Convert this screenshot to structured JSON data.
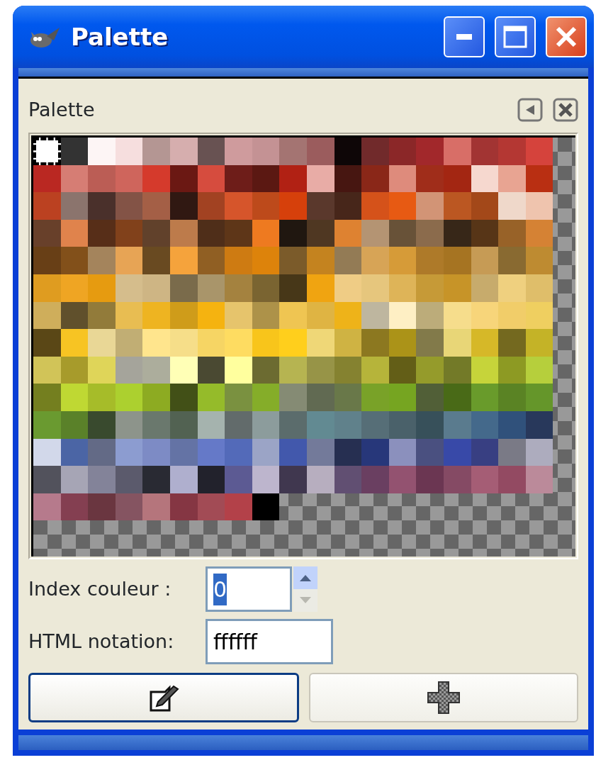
{
  "window": {
    "title": "Palette"
  },
  "panel": {
    "title": "Palette"
  },
  "palette": {
    "rows": [
      [
        {
          "color": "#ffffff",
          "selected": true
        },
        {
          "color": "#333333",
          "selected": false
        },
        {
          "color": "#fdf5f5",
          "selected": false
        },
        {
          "color": "#f6dede",
          "selected": false
        },
        {
          "color": "#b49693",
          "selected": false
        },
        {
          "color": "#d6aeae",
          "selected": false
        },
        {
          "color": "#685252",
          "selected": false
        },
        {
          "color": "#cf9b9d",
          "selected": false
        },
        {
          "color": "#c49294",
          "selected": false
        },
        {
          "color": "#a47472",
          "selected": false
        },
        {
          "color": "#9b5c5d",
          "selected": false
        },
        {
          "color": "#0e0607",
          "selected": false
        },
        {
          "color": "#712a2b",
          "selected": false
        },
        {
          "color": "#8b2728",
          "selected": false
        },
        {
          "color": "#a2282b",
          "selected": false
        },
        {
          "color": "#d86e67",
          "selected": false
        },
        {
          "color": "#a23433",
          "selected": false
        },
        {
          "color": "#b43733",
          "selected": false
        },
        {
          "color": "#d5433c",
          "selected": false
        }
      ],
      [
        {
          "color": "#ba2822",
          "selected": false
        },
        {
          "color": "#d67d74",
          "selected": false
        },
        {
          "color": "#bb5d55",
          "selected": false
        },
        {
          "color": "#cf655c",
          "selected": false
        },
        {
          "color": "#d53a2c",
          "selected": false
        },
        {
          "color": "#6b1813",
          "selected": false
        },
        {
          "color": "#d64c3e",
          "selected": false
        },
        {
          "color": "#6e1d19",
          "selected": false
        },
        {
          "color": "#5b1812",
          "selected": false
        },
        {
          "color": "#b12114",
          "selected": false
        },
        {
          "color": "#e8aca6",
          "selected": false
        },
        {
          "color": "#471611",
          "selected": false
        },
        {
          "color": "#8a2718",
          "selected": false
        },
        {
          "color": "#de8b7c",
          "selected": false
        },
        {
          "color": "#a02d1a",
          "selected": false
        },
        {
          "color": "#a32612",
          "selected": false
        },
        {
          "color": "#f6d8cf",
          "selected": false
        },
        {
          "color": "#e8a492",
          "selected": false
        },
        {
          "color": "#b92f12",
          "selected": false
        }
      ],
      [
        {
          "color": "#bb4121",
          "selected": false
        },
        {
          "color": "#8b746d",
          "selected": false
        },
        {
          "color": "#4a302b",
          "selected": false
        },
        {
          "color": "#835346",
          "selected": false
        },
        {
          "color": "#a45f46",
          "selected": false
        },
        {
          "color": "#301812",
          "selected": false
        },
        {
          "color": "#a24222",
          "selected": false
        },
        {
          "color": "#d6552b",
          "selected": false
        },
        {
          "color": "#bd4a1b",
          "selected": false
        },
        {
          "color": "#d6400b",
          "selected": false
        },
        {
          "color": "#5a382c",
          "selected": false
        },
        {
          "color": "#47261a",
          "selected": false
        },
        {
          "color": "#d5521a",
          "selected": false
        },
        {
          "color": "#e75a13",
          "selected": false
        },
        {
          "color": "#d29476",
          "selected": false
        },
        {
          "color": "#bb5722",
          "selected": false
        },
        {
          "color": "#a34819",
          "selected": false
        },
        {
          "color": "#efd8ca",
          "selected": false
        },
        {
          "color": "#efc4ae",
          "selected": false
        }
      ],
      [
        {
          "color": "#68402a",
          "selected": false
        },
        {
          "color": "#e0834c",
          "selected": false
        },
        {
          "color": "#572e18",
          "selected": false
        },
        {
          "color": "#81411b",
          "selected": false
        },
        {
          "color": "#61412b",
          "selected": false
        },
        {
          "color": "#bd7b4b",
          "selected": false
        },
        {
          "color": "#4f2e19",
          "selected": false
        },
        {
          "color": "#5e3618",
          "selected": false
        },
        {
          "color": "#ee7a20",
          "selected": false
        },
        {
          "color": "#201710",
          "selected": false
        },
        {
          "color": "#4f3722",
          "selected": false
        },
        {
          "color": "#de8231",
          "selected": false
        },
        {
          "color": "#b49473",
          "selected": false
        },
        {
          "color": "#685238",
          "selected": false
        },
        {
          "color": "#8b6b4c",
          "selected": false
        },
        {
          "color": "#372718",
          "selected": false
        },
        {
          "color": "#573517",
          "selected": false
        },
        {
          "color": "#986228",
          "selected": false
        },
        {
          "color": "#d58234",
          "selected": false
        }
      ],
      [
        {
          "color": "#683f16",
          "selected": false
        },
        {
          "color": "#82501a",
          "selected": false
        },
        {
          "color": "#a4845c",
          "selected": false
        },
        {
          "color": "#e7a455",
          "selected": false
        },
        {
          "color": "#694a21",
          "selected": false
        },
        {
          "color": "#f5a33c",
          "selected": false
        },
        {
          "color": "#905f23",
          "selected": false
        },
        {
          "color": "#ce7b12",
          "selected": false
        },
        {
          "color": "#dd830b",
          "selected": false
        },
        {
          "color": "#7b5b2a",
          "selected": false
        },
        {
          "color": "#c4831f",
          "selected": false
        },
        {
          "color": "#937b55",
          "selected": false
        },
        {
          "color": "#d7a456",
          "selected": false
        },
        {
          "color": "#d69b38",
          "selected": false
        },
        {
          "color": "#ae7a29",
          "selected": false
        },
        {
          "color": "#a67422",
          "selected": false
        },
        {
          "color": "#c69b55",
          "selected": false
        },
        {
          "color": "#896a31",
          "selected": false
        },
        {
          "color": "#be8b31",
          "selected": false
        }
      ],
      [
        {
          "color": "#df9c20",
          "selected": false
        },
        {
          "color": "#efa523",
          "selected": false
        },
        {
          "color": "#e69b10",
          "selected": false
        },
        {
          "color": "#d5bd8c",
          "selected": false
        },
        {
          "color": "#ceb584",
          "selected": false
        },
        {
          "color": "#7a6b4b",
          "selected": false
        },
        {
          "color": "#a9956a",
          "selected": false
        },
        {
          "color": "#a4823f",
          "selected": false
        },
        {
          "color": "#7a6431",
          "selected": false
        },
        {
          "color": "#473718",
          "selected": false
        },
        {
          "color": "#f0a411",
          "selected": false
        },
        {
          "color": "#efcc85",
          "selected": false
        },
        {
          "color": "#e6c67d",
          "selected": false
        },
        {
          "color": "#deb458",
          "selected": false
        },
        {
          "color": "#c69a37",
          "selected": false
        },
        {
          "color": "#c79428",
          "selected": false
        },
        {
          "color": "#c7ab6c",
          "selected": false
        },
        {
          "color": "#efd07f",
          "selected": false
        },
        {
          "color": "#dfbe6a",
          "selected": false
        }
      ],
      [
        {
          "color": "#cfae5b",
          "selected": false
        },
        {
          "color": "#60502c",
          "selected": false
        },
        {
          "color": "#927b3a",
          "selected": false
        },
        {
          "color": "#e8bd52",
          "selected": false
        },
        {
          "color": "#eeb421",
          "selected": false
        },
        {
          "color": "#cf9c1a",
          "selected": false
        },
        {
          "color": "#f5b310",
          "selected": false
        },
        {
          "color": "#e6c46c",
          "selected": false
        },
        {
          "color": "#ad9249",
          "selected": false
        },
        {
          "color": "#efc552",
          "selected": false
        },
        {
          "color": "#dfb443",
          "selected": false
        },
        {
          "color": "#eeb319",
          "selected": false
        },
        {
          "color": "#beb69f",
          "selected": false
        },
        {
          "color": "#feefc4",
          "selected": false
        },
        {
          "color": "#bcac7a",
          "selected": false
        },
        {
          "color": "#f6dd8c",
          "selected": false
        },
        {
          "color": "#f7d57a",
          "selected": false
        },
        {
          "color": "#f1cd69",
          "selected": false
        },
        {
          "color": "#efcf60",
          "selected": false
        }
      ],
      [
        {
          "color": "#5a4716",
          "selected": false
        },
        {
          "color": "#f7c423",
          "selected": false
        },
        {
          "color": "#e9d796",
          "selected": false
        },
        {
          "color": "#c1ae74",
          "selected": false
        },
        {
          "color": "#ffe58d",
          "selected": false
        },
        {
          "color": "#f6de89",
          "selected": false
        },
        {
          "color": "#f6d564",
          "selected": false
        },
        {
          "color": "#fedc61",
          "selected": false
        },
        {
          "color": "#f8c51b",
          "selected": false
        },
        {
          "color": "#ffcf1c",
          "selected": false
        },
        {
          "color": "#efd777",
          "selected": false
        },
        {
          "color": "#cfb343",
          "selected": false
        },
        {
          "color": "#8c7820",
          "selected": false
        },
        {
          "color": "#ab9318",
          "selected": false
        },
        {
          "color": "#827a4a",
          "selected": false
        },
        {
          "color": "#e8d677",
          "selected": false
        },
        {
          "color": "#d6b828",
          "selected": false
        },
        {
          "color": "#74691f",
          "selected": false
        },
        {
          "color": "#c4b327",
          "selected": false
        }
      ],
      [
        {
          "color": "#d1c458",
          "selected": false
        },
        {
          "color": "#a79b2b",
          "selected": false
        },
        {
          "color": "#dfd559",
          "selected": false
        },
        {
          "color": "#a5a49b",
          "selected": false
        },
        {
          "color": "#acad9c",
          "selected": false
        },
        {
          "color": "#ffffb6",
          "selected": false
        },
        {
          "color": "#4a4932",
          "selected": false
        },
        {
          "color": "#ffff9e",
          "selected": false
        },
        {
          "color": "#6c6b31",
          "selected": false
        },
        {
          "color": "#b6b451",
          "selected": false
        },
        {
          "color": "#979447",
          "selected": false
        },
        {
          "color": "#858230",
          "selected": false
        },
        {
          "color": "#b6b43a",
          "selected": false
        },
        {
          "color": "#635e17",
          "selected": false
        },
        {
          "color": "#959b2b",
          "selected": false
        },
        {
          "color": "#737a28",
          "selected": false
        },
        {
          "color": "#c6d43a",
          "selected": false
        },
        {
          "color": "#8d9a23",
          "selected": false
        },
        {
          "color": "#b6cf3c",
          "selected": false
        }
      ],
      [
        {
          "color": "#747f1f",
          "selected": false
        },
        {
          "color": "#bfd833",
          "selected": false
        },
        {
          "color": "#a6bc29",
          "selected": false
        },
        {
          "color": "#acd02f",
          "selected": false
        },
        {
          "color": "#8dab22",
          "selected": false
        },
        {
          "color": "#425017",
          "selected": false
        },
        {
          "color": "#95bb2a",
          "selected": false
        },
        {
          "color": "#7a9140",
          "selected": false
        },
        {
          "color": "#85ad29",
          "selected": false
        },
        {
          "color": "#858b74",
          "selected": false
        },
        {
          "color": "#616a52",
          "selected": false
        },
        {
          "color": "#697849",
          "selected": false
        },
        {
          "color": "#79a228",
          "selected": false
        },
        {
          "color": "#76a521",
          "selected": false
        },
        {
          "color": "#515f37",
          "selected": false
        },
        {
          "color": "#496a17",
          "selected": false
        },
        {
          "color": "#699b2b",
          "selected": false
        },
        {
          "color": "#5a8324",
          "selected": false
        },
        {
          "color": "#65962a",
          "selected": false
        }
      ],
      [
        {
          "color": "#6a9a30",
          "selected": false
        },
        {
          "color": "#5a8129",
          "selected": false
        },
        {
          "color": "#394a2e",
          "selected": false
        },
        {
          "color": "#8d948b",
          "selected": false
        },
        {
          "color": "#6a786d",
          "selected": false
        },
        {
          "color": "#526252",
          "selected": false
        },
        {
          "color": "#a5b3ae",
          "selected": false
        },
        {
          "color": "#626b6b",
          "selected": false
        },
        {
          "color": "#8c9c9c",
          "selected": false
        },
        {
          "color": "#5b6c6c",
          "selected": false
        },
        {
          "color": "#628a92",
          "selected": false
        },
        {
          "color": "#60818b",
          "selected": false
        },
        {
          "color": "#566e77",
          "selected": false
        },
        {
          "color": "#4a616a",
          "selected": false
        },
        {
          "color": "#37505a",
          "selected": false
        },
        {
          "color": "#5a7b8e",
          "selected": false
        },
        {
          "color": "#44698b",
          "selected": false
        },
        {
          "color": "#30517b",
          "selected": false
        },
        {
          "color": "#28385b",
          "selected": false
        }
      ],
      [
        {
          "color": "#d2d8ea",
          "selected": false
        },
        {
          "color": "#4b65a5",
          "selected": false
        },
        {
          "color": "#636a86",
          "selected": false
        },
        {
          "color": "#8c9cd0",
          "selected": false
        },
        {
          "color": "#7d8bc5",
          "selected": false
        },
        {
          "color": "#6473a5",
          "selected": false
        },
        {
          "color": "#6579c8",
          "selected": false
        },
        {
          "color": "#536ab9",
          "selected": false
        },
        {
          "color": "#9ba4c6",
          "selected": false
        },
        {
          "color": "#4258ac",
          "selected": false
        },
        {
          "color": "#737a9a",
          "selected": false
        },
        {
          "color": "#262f51",
          "selected": false
        },
        {
          "color": "#27377a",
          "selected": false
        },
        {
          "color": "#8b90bd",
          "selected": false
        },
        {
          "color": "#4a5080",
          "selected": false
        },
        {
          "color": "#3849a8",
          "selected": false
        },
        {
          "color": "#383f82",
          "selected": false
        },
        {
          "color": "#7a7a86",
          "selected": false
        },
        {
          "color": "#adacbe",
          "selected": false
        }
      ],
      [
        {
          "color": "#52525c",
          "selected": false
        },
        {
          "color": "#a6a5b5",
          "selected": false
        },
        {
          "color": "#838399",
          "selected": false
        },
        {
          "color": "#5b5a6c",
          "selected": false
        },
        {
          "color": "#292a33",
          "selected": false
        },
        {
          "color": "#afafce",
          "selected": false
        },
        {
          "color": "#22222c",
          "selected": false
        },
        {
          "color": "#5c5a93",
          "selected": false
        },
        {
          "color": "#bdb5cd",
          "selected": false
        },
        {
          "color": "#40374f",
          "selected": false
        },
        {
          "color": "#b7aebf",
          "selected": false
        },
        {
          "color": "#614f72",
          "selected": false
        },
        {
          "color": "#6a3f61",
          "selected": false
        },
        {
          "color": "#935270",
          "selected": false
        },
        {
          "color": "#6b3652",
          "selected": false
        },
        {
          "color": "#854a64",
          "selected": false
        },
        {
          "color": "#a55d75",
          "selected": false
        },
        {
          "color": "#934a62",
          "selected": false
        },
        {
          "color": "#bb8a9a",
          "selected": false
        }
      ],
      [
        {
          "color": "#b67a8c",
          "selected": false
        },
        {
          "color": "#843f51",
          "selected": false
        },
        {
          "color": "#6a3640",
          "selected": false
        },
        {
          "color": "#855461",
          "selected": false
        },
        {
          "color": "#b5757c",
          "selected": false
        },
        {
          "color": "#853643",
          "selected": false
        },
        {
          "color": "#a24b55",
          "selected": false
        },
        {
          "color": "#b34149",
          "selected": false
        },
        {
          "color": "#000000",
          "selected": false
        }
      ]
    ]
  },
  "index_field": {
    "label": "Index couleur :",
    "value": "0",
    "text_selected": true,
    "up_disabled": false,
    "down_disabled": true
  },
  "html_field": {
    "label": "HTML notation:",
    "value": "ffffff"
  },
  "buttons": [
    {
      "kind": "edit",
      "focused": true
    },
    {
      "kind": "add",
      "focused": false
    }
  ]
}
